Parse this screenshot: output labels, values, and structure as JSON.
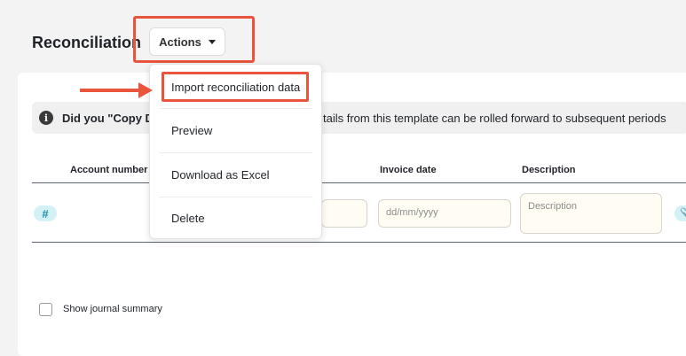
{
  "header": {
    "title": "Reconciliation",
    "actions_label": "Actions",
    "caret_icon": "caret-down-icon"
  },
  "info_banner": {
    "icon": "info-icon",
    "bold_text": "Did you \"Copy D",
    "rest_text": "tails from this template can be rolled forward to subsequent periods"
  },
  "table": {
    "columns": [
      "Account number",
      "Invoice date",
      "Description"
    ],
    "row": {
      "badge": "#",
      "date_placeholder": "dd/mm/yyyy",
      "description_placeholder": "Description",
      "attach_icon": "paperclip-icon"
    }
  },
  "footer": {
    "show_journal_label": "Show journal summary"
  },
  "dropdown": {
    "items": [
      {
        "label": "Import reconciliation data",
        "highlighted": true
      },
      {
        "label": "Preview"
      },
      {
        "label": "Download as Excel"
      },
      {
        "label": "Delete"
      }
    ]
  },
  "annotation": {
    "color": "#e8553c"
  }
}
